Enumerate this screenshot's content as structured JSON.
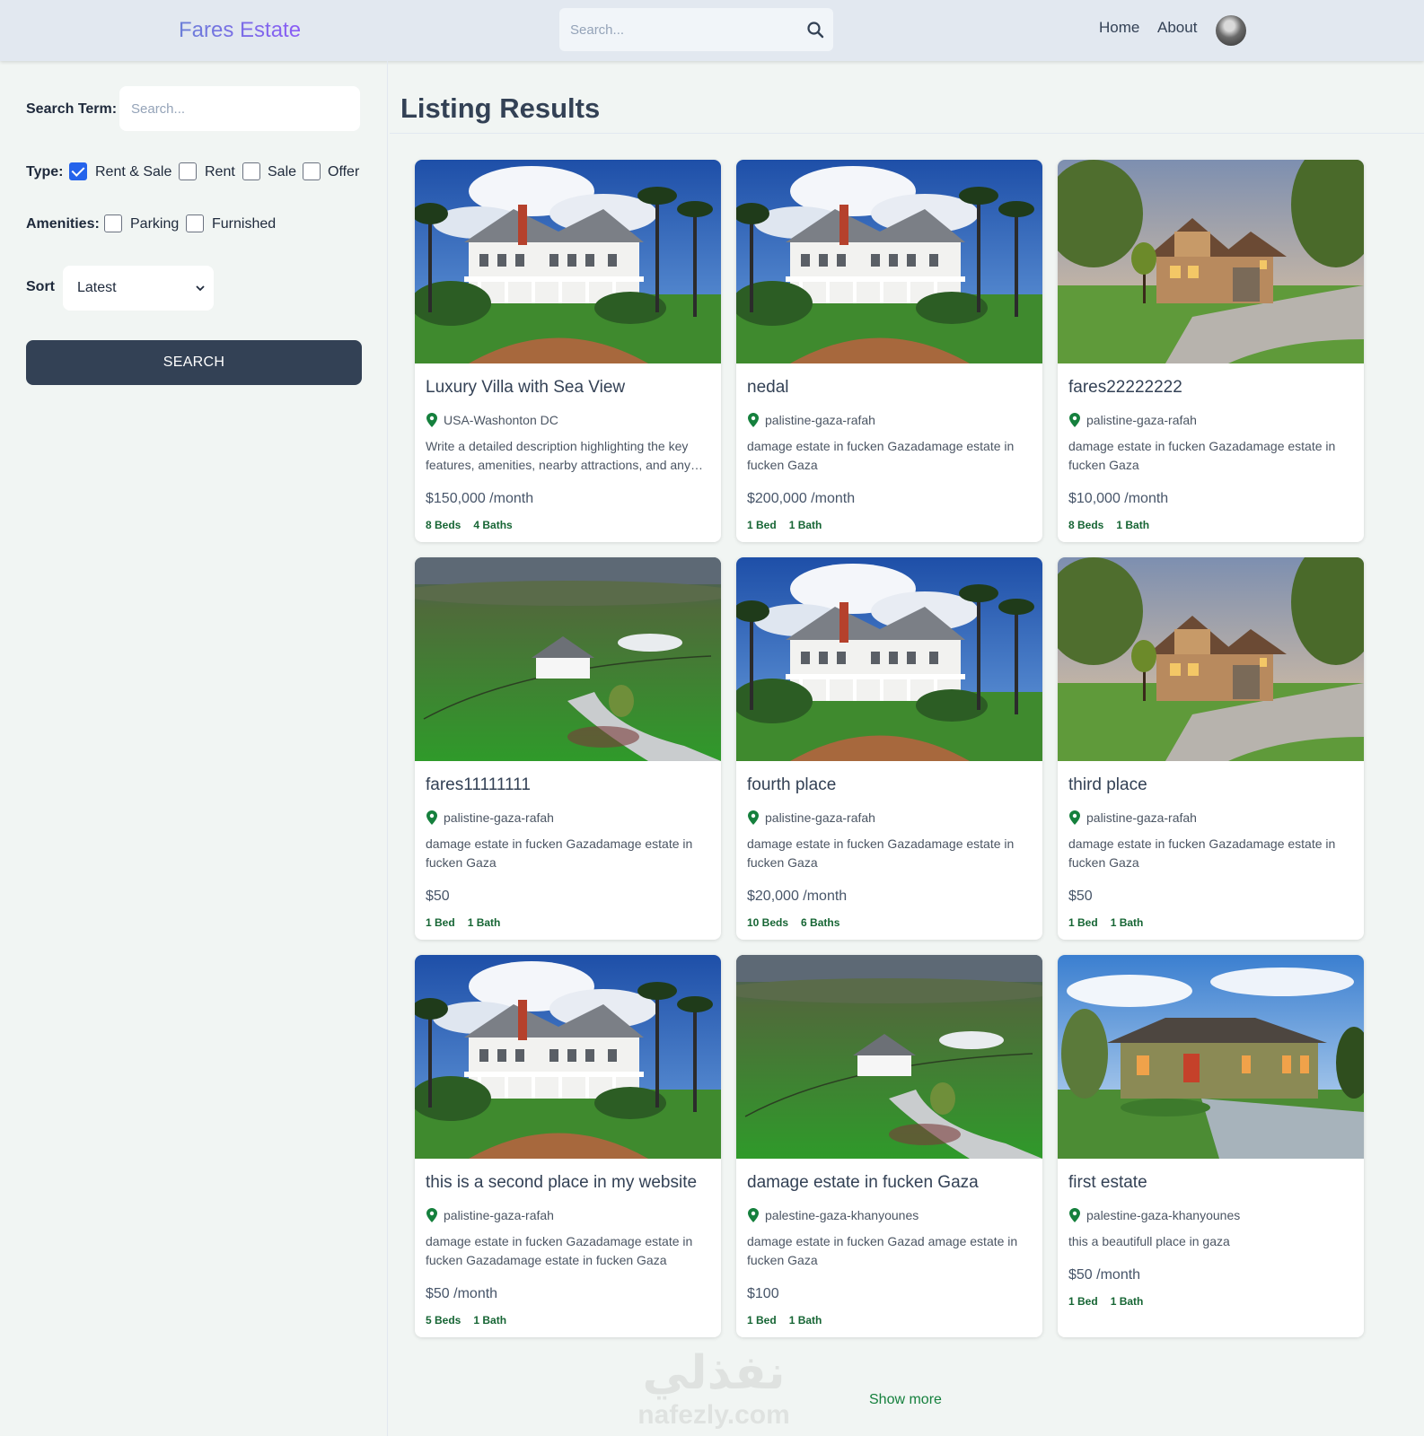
{
  "header": {
    "brand": "Fares Estate",
    "search_placeholder": "Search...",
    "nav": {
      "home": "Home",
      "about": "About"
    }
  },
  "sidebar": {
    "search_term_label": "Search Term:",
    "search_term_placeholder": "Search...",
    "type_label": "Type:",
    "type_options": [
      {
        "label": "Rent & Sale",
        "checked": true
      },
      {
        "label": "Rent",
        "checked": false
      },
      {
        "label": "Sale",
        "checked": false
      },
      {
        "label": "Offer",
        "checked": false
      }
    ],
    "amenities_label": "Amenities:",
    "amenity_options": [
      {
        "label": "Parking",
        "checked": false
      },
      {
        "label": "Furnished",
        "checked": false
      }
    ],
    "sort_label": "Sort",
    "sort_value": "Latest",
    "search_button": "SEARCH"
  },
  "main": {
    "title": "Listing Results",
    "listings": [
      {
        "image": "villa",
        "title": "Luxury Villa with Sea View",
        "location": "USA-Washonton DC",
        "description": "Write a detailed description highlighting the key features, amenities, nearby attractions, and any unique selling points that make this property stand out.",
        "price": "$150,000 /month",
        "beds": "8 Beds",
        "baths": "4 Baths"
      },
      {
        "image": "villa",
        "title": "nedal",
        "location": "palistine-gaza-rafah",
        "description": "damage estate in fucken Gazadamage estate in fucken Gaza",
        "price": "$200,000 /month",
        "beds": "1 Bed",
        "baths": "1 Bath"
      },
      {
        "image": "stone-house",
        "title": "fares22222222",
        "location": "palistine-gaza-rafah",
        "description": "damage estate in fucken Gazadamage estate in fucken Gaza",
        "price": "$10,000 /month",
        "beds": "8 Beds",
        "baths": "1 Bath"
      },
      {
        "image": "aerial-farm",
        "title": "fares11111111",
        "location": "palistine-gaza-rafah",
        "description": "damage estate in fucken Gazadamage estate in fucken Gaza",
        "price": "$50",
        "beds": "1 Bed",
        "baths": "1 Bath"
      },
      {
        "image": "villa",
        "title": "fourth place",
        "location": "palistine-gaza-rafah",
        "description": "damage estate in fucken Gazadamage estate in fucken Gaza",
        "price": "$20,000 /month",
        "beds": "10 Beds",
        "baths": "6 Baths"
      },
      {
        "image": "stone-house",
        "title": "third place",
        "location": "palistine-gaza-rafah",
        "description": "damage estate in fucken Gazadamage estate in fucken Gaza",
        "price": "$50",
        "beds": "1 Bed",
        "baths": "1 Bath"
      },
      {
        "image": "villa",
        "title": "this is a second place in my website",
        "location": "palistine-gaza-rafah",
        "description": "damage estate in fucken Gazadamage estate in fucken Gazadamage estate in fucken Gaza",
        "price": "$50 /month",
        "beds": "5 Beds",
        "baths": "1 Bath"
      },
      {
        "image": "aerial-farm",
        "title": "damage estate in fucken Gaza",
        "location": "palestine-gaza-khanyounes",
        "description": "damage estate in fucken Gazad amage estate in fucken Gaza",
        "price": "$100",
        "beds": "1 Bed",
        "baths": "1 Bath"
      },
      {
        "image": "modern-house",
        "title": "first estate",
        "location": "palestine-gaza-khanyounes",
        "description": "this a beautifull place in gaza",
        "price": "$50 /month",
        "beds": "1 Bed",
        "baths": "1 Bath"
      }
    ],
    "show_more": "Show more"
  },
  "watermark": {
    "arabic": "نفذلي",
    "latin": "nafezly.com"
  },
  "colors": {
    "accent_green": "#15803d",
    "button_dark": "#334155",
    "checkbox_blue": "#2563eb"
  }
}
